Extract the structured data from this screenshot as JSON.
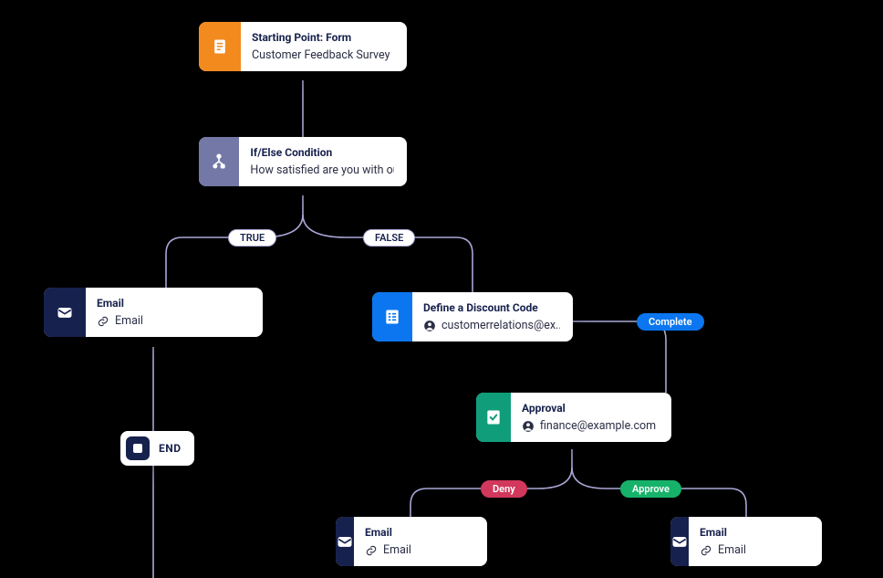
{
  "nodes": {
    "start": {
      "title": "Starting Point: Form",
      "subtitle": "Customer Feedback Survey"
    },
    "cond": {
      "title": "If/Else Condition",
      "subtitle": "How satisfied are you with ou"
    },
    "emailT": {
      "title": "Email",
      "subtitle": "Email"
    },
    "discount": {
      "title": "Define a Discount Code",
      "subtitle": "customerrelations@ex..."
    },
    "approval": {
      "title": "Approval",
      "subtitle": "finance@example.com"
    },
    "emailDeny": {
      "title": "Email",
      "subtitle": "Email"
    },
    "emailAppr": {
      "title": "Email",
      "subtitle": "Email"
    }
  },
  "labels": {
    "true": "TRUE",
    "false": "FALSE",
    "complete": "Complete",
    "deny": "Deny",
    "approve": "Approve",
    "end": "END"
  },
  "colors": {
    "orange": "#f28a1e",
    "slate": "#7478a6",
    "navy": "#17214d",
    "blue": "#0b76ef",
    "teal": "#109e7a",
    "wire": "#a9a7d6"
  }
}
